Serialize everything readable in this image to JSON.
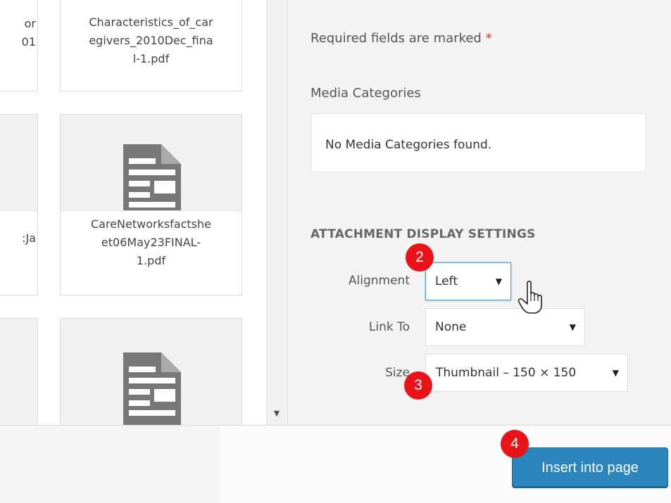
{
  "media_grid": {
    "tiles": [
      {
        "caption": "or\n01"
      },
      {
        "caption": "Characteristics_of_car\negivers_2010Dec_fina\nl-1.pdf"
      },
      {
        "caption": "Ja"
      },
      {
        "caption": "CareNetworksfactshe\net06May23FINAL-\n1.pdf",
        "icon": "document-icon"
      },
      {
        "caption": ""
      },
      {
        "caption": "",
        "icon": "document-icon"
      }
    ]
  },
  "sidebar": {
    "required_text": "Required fields are marked",
    "required_star": "*",
    "media_categories": {
      "label": "Media Categories",
      "empty_message": "No Media Categories found."
    },
    "display_settings": {
      "title": "ATTACHMENT DISPLAY SETTINGS",
      "alignment": {
        "label": "Alignment",
        "value": "Left"
      },
      "link_to": {
        "label": "Link To",
        "value": "None"
      },
      "size": {
        "label": "Size",
        "value": "Thumbnail – 150 × 150"
      }
    }
  },
  "annotations": {
    "step_2": "2",
    "step_3": "3",
    "step_4": "4"
  },
  "footer": {
    "insert_button": "Insert into page"
  },
  "colors": {
    "accent": "#2a86bb",
    "badge": "#e8141a",
    "required_star": "#d63638"
  }
}
